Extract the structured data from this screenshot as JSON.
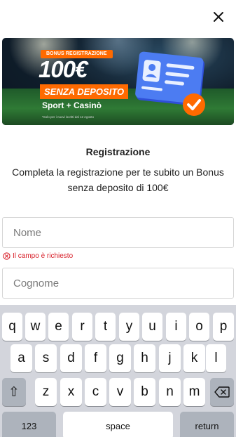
{
  "dialog": {
    "close_icon": "close-icon",
    "banner": {
      "pill": "BONUS REGISTRAZIONE",
      "amount": "100€",
      "no_deposit": "SENZA DEPOSITO",
      "products": "Sport + Casinò",
      "fine_print": "*Solo per i nuovi iscritti dal 12 Agosto",
      "illustration": "id-card-check-icon",
      "accent": "#ff6a00"
    },
    "title": "Registrazione",
    "subtitle": "Completa la registrazione per te subito un Bonus senza deposito di 100€",
    "fields": {
      "first_name_placeholder": "Nome",
      "last_name_placeholder": "Cognome"
    },
    "error_icon": "error-circle-icon",
    "error_text": "Il campo è richiesto",
    "error_color": "#d8202a"
  },
  "keyboard": {
    "row1": [
      "q",
      "w",
      "e",
      "r",
      "t",
      "y",
      "u",
      "i",
      "o",
      "p"
    ],
    "row2": [
      "a",
      "s",
      "d",
      "f",
      "g",
      "h",
      "j",
      "k",
      "l"
    ],
    "row3": [
      "z",
      "x",
      "c",
      "v",
      "b",
      "n",
      "m"
    ],
    "shift_glyph": "⇧",
    "shift_icon": "shift-icon",
    "backspace_icon": "backspace-icon",
    "numbers_label": "123",
    "space_label": "space",
    "return_label": "return"
  }
}
